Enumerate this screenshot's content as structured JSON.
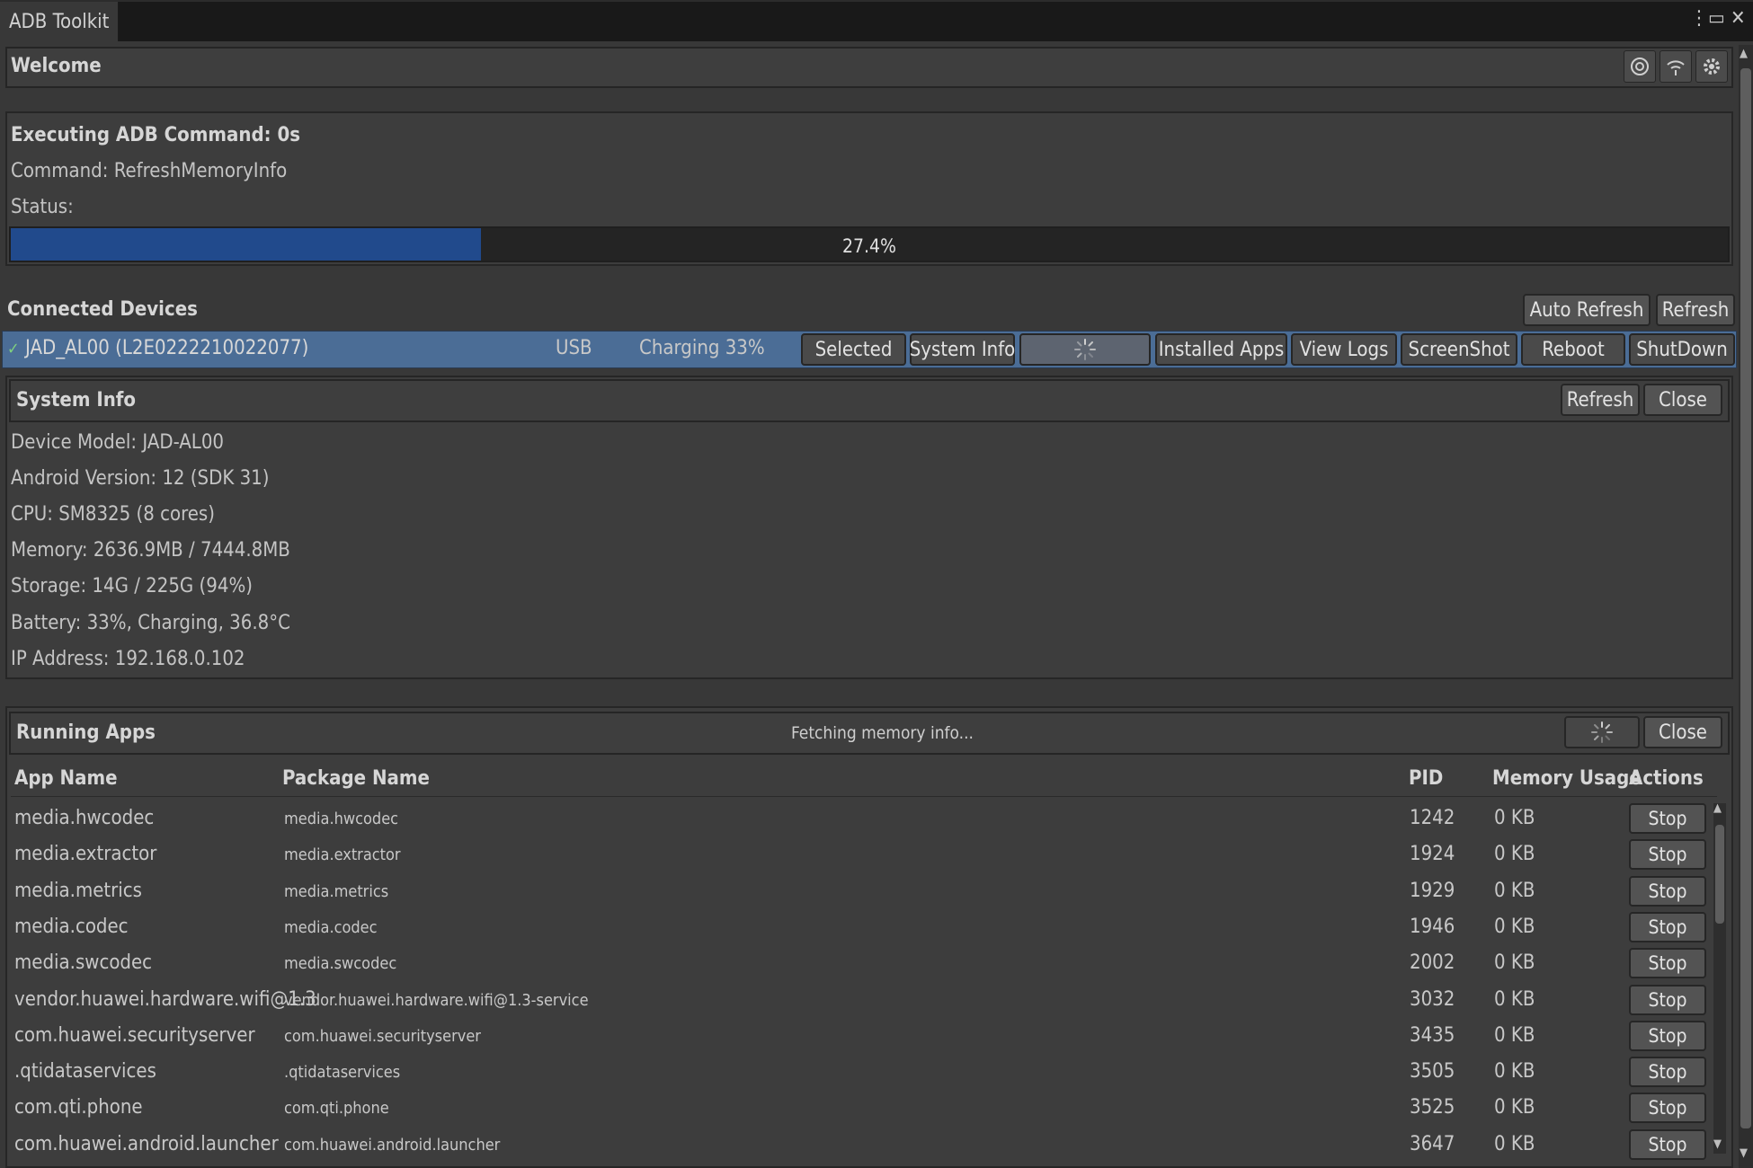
{
  "window": {
    "tab_title": "ADB Toolkit",
    "controls": {
      "menu": "⋮",
      "maximize": "▭",
      "close": "✕"
    }
  },
  "welcome": {
    "title": "Welcome",
    "icons": [
      "camera-icon",
      "wifi-icon",
      "gear-icon"
    ]
  },
  "execution": {
    "heading": "Executing ADB Command: 0s",
    "command_line": "Command: RefreshMemoryInfo",
    "status_line": "Status:",
    "progress_percent": 27.4,
    "progress_label": "27.4%"
  },
  "connected_devices": {
    "title": "Connected Devices",
    "auto_refresh_label": "Auto Refresh",
    "refresh_label": "Refresh",
    "device": {
      "check": "✓",
      "name": "JAD_AL00 (L2E0222210022077)",
      "connection": "USB",
      "battery": "Charging 33%",
      "buttons": {
        "selected": "Selected",
        "system_info": "System Info",
        "installed_apps": "Installed Apps",
        "view_logs": "View Logs",
        "screenshot": "ScreenShot",
        "reboot": "Reboot",
        "shutdown": "ShutDown"
      }
    }
  },
  "system_info": {
    "title": "System Info",
    "refresh_label": "Refresh",
    "close_label": "Close",
    "lines": [
      "Device Model: JAD-AL00",
      "Android Version: 12 (SDK 31)",
      "CPU: SM8325 (8 cores)",
      "Memory: 2636.9MB / 7444.8MB",
      "Storage: 14G / 225G (94%)",
      "Battery: 33%, Charging, 36.8°C",
      "IP Address: 192.168.0.102"
    ]
  },
  "running_apps": {
    "title": "Running Apps",
    "status": "Fetching memory info...",
    "close_label": "Close",
    "columns": {
      "app": "App Name",
      "package": "Package Name",
      "pid": "PID",
      "memory": "Memory Usage",
      "actions": "Actions"
    },
    "stop_label": "Stop",
    "rows": [
      {
        "app": "media.hwcodec",
        "package": "media.hwcodec",
        "pid": "1242",
        "memory": "0 KB"
      },
      {
        "app": "media.extractor",
        "package": "media.extractor",
        "pid": "1924",
        "memory": "0 KB"
      },
      {
        "app": "media.metrics",
        "package": "media.metrics",
        "pid": "1929",
        "memory": "0 KB"
      },
      {
        "app": "media.codec",
        "package": "media.codec",
        "pid": "1946",
        "memory": "0 KB"
      },
      {
        "app": "media.swcodec",
        "package": "media.swcodec",
        "pid": "2002",
        "memory": "0 KB"
      },
      {
        "app": "vendor.huawei.hardware.wifi@1.3",
        "package": "vendor.huawei.hardware.wifi@1.3-service",
        "pid": "3032",
        "memory": "0 KB"
      },
      {
        "app": "com.huawei.securityserver",
        "package": "com.huawei.securityserver",
        "pid": "3435",
        "memory": "0 KB"
      },
      {
        "app": ".qtidataservices",
        "package": ".qtidataservices",
        "pid": "3505",
        "memory": "0 KB"
      },
      {
        "app": "com.qti.phone",
        "package": "com.qti.phone",
        "pid": "3525",
        "memory": "0 KB"
      },
      {
        "app": "com.huawei.android.launcher",
        "package": "com.huawei.android.launcher",
        "pid": "3647",
        "memory": "0 KB"
      }
    ]
  }
}
